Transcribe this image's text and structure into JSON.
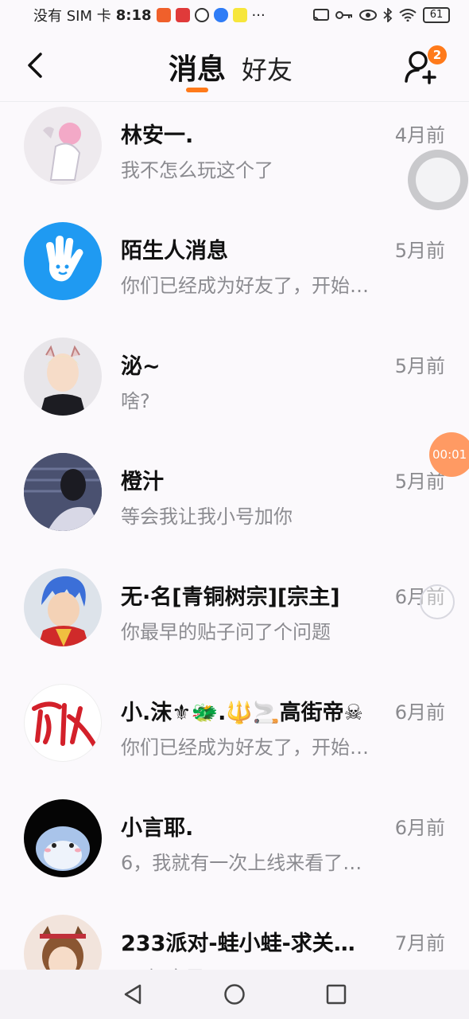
{
  "status_bar": {
    "carrier": "没有 SIM 卡",
    "time": "8:18",
    "more": "···",
    "battery": "61"
  },
  "header": {
    "tab_messages": "消息",
    "tab_friends": "好友",
    "friend_request_badge": "2"
  },
  "conversations": [
    {
      "name": "林安一.",
      "preview": "我不怎么玩这个了",
      "time": "4月前"
    },
    {
      "name": "陌生人消息",
      "preview": "你们已经成为好友了，开始…",
      "time": "5月前"
    },
    {
      "name": "泌~",
      "preview": "啥?",
      "time": "5月前"
    },
    {
      "name": "橙汁",
      "preview": "等会我让我小号加你",
      "time": "5月前"
    },
    {
      "name": "无·名[青铜树宗][宗主]",
      "preview": "你最早的贴子问了个问题",
      "time": "6月前"
    },
    {
      "name": "小.沫⚜🐲.🔱🚬高街帝☠",
      "preview": "你们已经成为好友了，开始…",
      "time": "6月前"
    },
    {
      "name": "小言耶.",
      "preview": "6，我就有一次上线来看了…",
      "time": "6月前"
    },
    {
      "name": "233派对-蛙小蛙-求关…",
      "preview": "[不好意思]",
      "time": "7月前"
    }
  ],
  "overlay": {
    "record_timer": "00:01"
  },
  "colors": {
    "accent": "#ff7a1a",
    "background": "#fbf9fc",
    "secondary_text": "#8b8b90"
  },
  "icons": [
    "back-arrow-icon",
    "add-friend-icon",
    "stranger-hand-icon",
    "nav-back-icon",
    "nav-home-icon",
    "nav-recents-icon"
  ]
}
